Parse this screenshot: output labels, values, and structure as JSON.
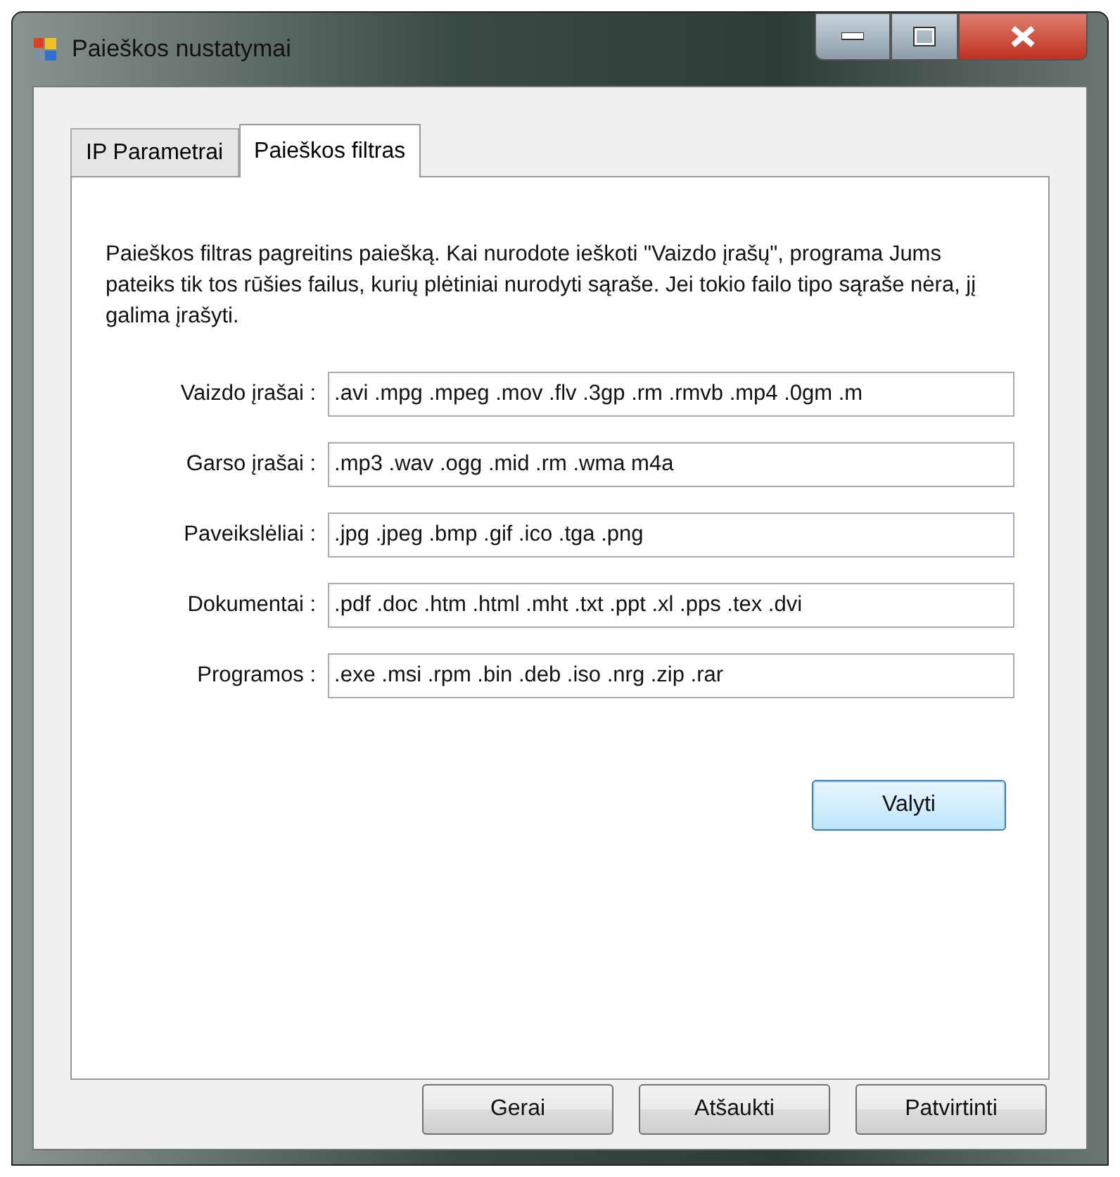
{
  "window": {
    "title": "Paieškos nustatymai"
  },
  "tabs": [
    {
      "label": "IP Parametrai",
      "selected": false
    },
    {
      "label": "Paieškos filtras",
      "selected": true
    }
  ],
  "description": "Paieškos filtras pagreitins paiešką. Kai nurodote ieškoti \"Vaizdo įrašų\", programa Jums pateiks tik tos rūšies failus, kurių plėtiniai nurodyti sąraše. Jei tokio failo tipo sąraše nėra, jį galima įrašyti.",
  "filters": [
    {
      "label": "Vaizdo įrašai :",
      "value": ".avi .mpg .mpeg .mov .flv .3gp .rm .rmvb .mp4 .0gm .m"
    },
    {
      "label": "Garso įrašai :",
      "value": ".mp3 .wav .ogg .mid .rm .wma m4a"
    },
    {
      "label": "Paveikslėliai :",
      "value": ".jpg .jpeg .bmp .gif .ico .tga .png"
    },
    {
      "label": "Dokumentai :",
      "value": ".pdf .doc .htm .html .mht .txt .ppt .xl .pps .tex .dvi"
    },
    {
      "label": "Programos :",
      "value": ".exe .msi .rpm .bin .deb .iso .nrg .zip .rar"
    }
  ],
  "clear_button": "Valyti",
  "buttons": [
    "Gerai",
    "Atšaukti",
    "Patvirtinti"
  ]
}
